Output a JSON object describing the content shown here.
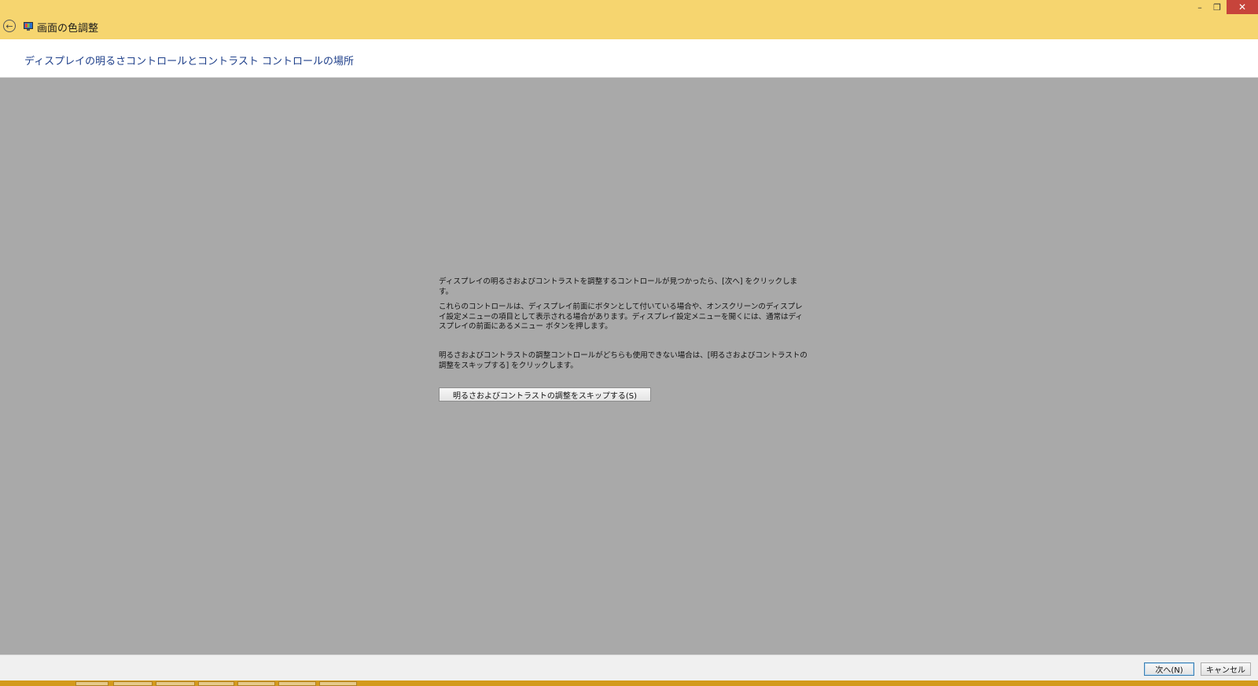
{
  "window": {
    "title": "画面の色調整",
    "controls": {
      "minimize": "–",
      "maximize": "❐",
      "close": "✕"
    }
  },
  "header": {
    "page_title": "ディスプレイの明るさコントロールとコントラスト コントロールの場所"
  },
  "main": {
    "paragraph1": "ディスプレイの明るさおよびコントラストを調整するコントロールが見つかったら、[次へ] をクリックします。",
    "paragraph2": "これらのコントロールは、ディスプレイ前面にボタンとして付いている場合や、オンスクリーンのディスプレイ設定メニューの項目として表示される場合があります。ディスプレイ設定メニューを開くには、通常はディスプレイの前面にあるメニュー ボタンを押します。",
    "paragraph3": "明るさおよびコントラストの調整コントロールがどちらも使用できない場合は、[明るさおよびコントラストの調整をスキップする] をクリックします。",
    "skip_button": "明るさおよびコントラストの調整をスキップする(S)"
  },
  "footer": {
    "next_button": "次へ(N)",
    "cancel_button": "キャンセル"
  },
  "icons": {
    "back": "back-arrow-icon",
    "app": "display-calibration-icon"
  },
  "colors": {
    "titlebar": "#f6d56f",
    "background": "#a9a9a9",
    "title_text": "#1e3f8a",
    "close_button": "#c7443b",
    "taskbar": "#d39a1c"
  }
}
